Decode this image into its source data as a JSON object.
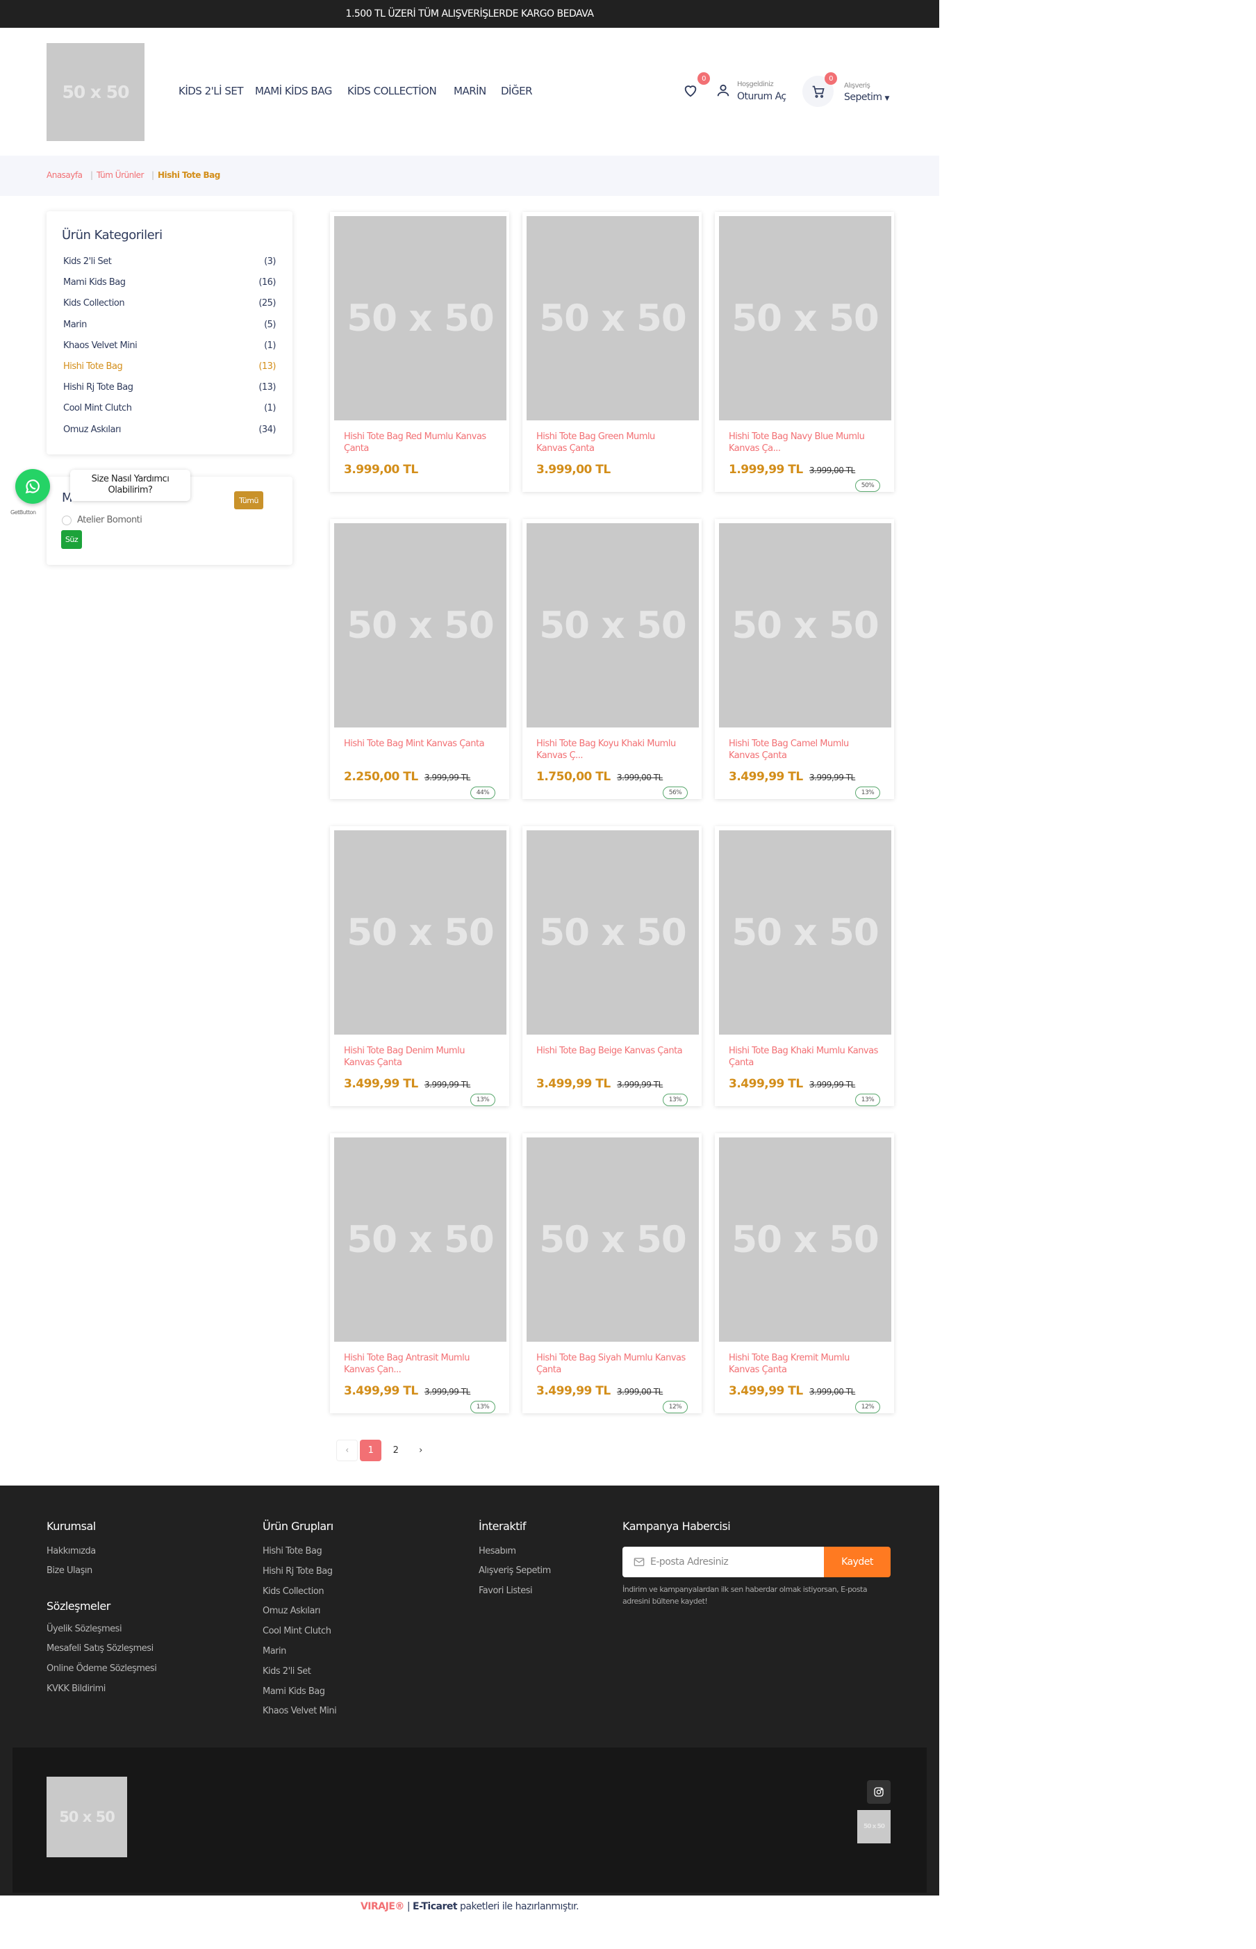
{
  "topbar": {
    "text": "1.500 TL ÜZERİ TÜM ALIŞVERİŞLERDE KARGO BEDAVA"
  },
  "logo": {
    "text": "50 x 50"
  },
  "nav": [
    "KİDS 2'Lİ SET",
    "MAMİ KİDS BAG",
    "KİDS COLLECTİON",
    "MARİN",
    "DİĞER"
  ],
  "header": {
    "wishlist_count": "0",
    "greeting": "Hoşgeldiniz",
    "login": "Oturum Aç",
    "cart_count": "0",
    "cart_small": "Alışveriş",
    "cart_label": "Sepetim"
  },
  "breadcrumb": [
    "Anasayfa",
    "Tüm Ürünler",
    "Hishi Tote Bag"
  ],
  "categories": {
    "title": "Ürün Kategorileri",
    "items": [
      {
        "name": "Kids 2'li Set",
        "count": "(3)"
      },
      {
        "name": "Mami Kids Bag",
        "count": "(16)"
      },
      {
        "name": "Kids Collection",
        "count": "(25)"
      },
      {
        "name": "Marin",
        "count": "(5)"
      },
      {
        "name": "Khaos Velvet Mini",
        "count": "(1)"
      },
      {
        "name": "Hishi Tote Bag",
        "count": "(13)"
      },
      {
        "name": "Hishi Rj Tote Bag",
        "count": "(13)"
      },
      {
        "name": "Cool Mint Clutch",
        "count": "(1)"
      },
      {
        "name": "Omuz Askıları",
        "count": "(34)"
      }
    ],
    "active_index": 5
  },
  "brand_filter": {
    "title_visible": "M",
    "all_button": "Tümü",
    "option": "Atelier Bomonti",
    "filter_button": "Süz"
  },
  "whatsapp": {
    "tooltip": "Size Nasıl Yardımcı Olabilirim?",
    "credit": "GetButton"
  },
  "products": [
    {
      "name": "Hishi Tote Bag Red Mumlu Kanvas Çanta",
      "price": "3.999,00 TL",
      "old": "",
      "disc": ""
    },
    {
      "name": "Hishi Tote Bag Green Mumlu Kanvas Çanta",
      "price": "3.999,00 TL",
      "old": "",
      "disc": ""
    },
    {
      "name": "Hishi Tote Bag Navy Blue Mumlu Kanvas Ça...",
      "price": "1.999,99 TL",
      "old": "3.999,00 TL",
      "disc": "50%"
    },
    {
      "name": "Hishi Tote Bag Mint Kanvas Çanta",
      "price": "2.250,00 TL",
      "old": "3.999,99 TL",
      "disc": "44%"
    },
    {
      "name": "Hishi Tote Bag Koyu Khaki Mumlu Kanvas Ç...",
      "price": "1.750,00 TL",
      "old": "3.999,00 TL",
      "disc": "56%"
    },
    {
      "name": "Hishi Tote Bag Camel Mumlu Kanvas Çanta",
      "price": "3.499,99 TL",
      "old": "3.999,99 TL",
      "disc": "13%"
    },
    {
      "name": "Hishi Tote Bag Denim Mumlu Kanvas Çanta",
      "price": "3.499,99 TL",
      "old": "3.999,99 TL",
      "disc": "13%"
    },
    {
      "name": "Hishi Tote Bag Beige Kanvas Çanta",
      "price": "3.499,99 TL",
      "old": "3.999,99 TL",
      "disc": "13%"
    },
    {
      "name": "Hishi Tote Bag Khaki Mumlu Kanvas Çanta",
      "price": "3.499,99 TL",
      "old": "3.999,99 TL",
      "disc": "13%"
    },
    {
      "name": "Hishi Tote Bag Antrasit Mumlu Kanvas Çan...",
      "price": "3.499,99 TL",
      "old": "3.999,99 TL",
      "disc": "13%"
    },
    {
      "name": "Hishi Tote Bag Siyah Mumlu Kanvas Çanta",
      "price": "3.499,99 TL",
      "old": "3.999,00 TL",
      "disc": "12%"
    },
    {
      "name": "Hishi Tote Bag Kremit Mumlu Kanvas Çanta",
      "price": "3.499,99 TL",
      "old": "3.999,00 TL",
      "disc": "12%"
    }
  ],
  "pagination": {
    "prev": "‹",
    "pages": [
      "1",
      "2"
    ],
    "next": "›",
    "current": "1"
  },
  "footer": {
    "kurumsal": {
      "title": "Kurumsal",
      "links": [
        "Hakkımızda",
        "Bize Ulaşın"
      ]
    },
    "sozlesmeler": {
      "title": "Sözleşmeler",
      "links": [
        "Üyelik Sözleşmesi",
        "Mesafeli Satış Sözleşmesi",
        "Online Ödeme Sözleşmesi",
        "KVKK Bildirimi"
      ]
    },
    "gruplar": {
      "title": "Ürün Grupları",
      "links": [
        "Hishi Tote Bag",
        "Hishi Rj Tote Bag",
        "Kids Collection",
        "Omuz Askıları",
        "Cool Mint Clutch",
        "Marin",
        "Kids 2'li Set",
        "Mami Kids Bag",
        "Khaos Velvet Mini"
      ]
    },
    "interaktif": {
      "title": "İnteraktif",
      "links": [
        "Hesabım",
        "Alışveriş Sepetim",
        "Favori Listesi"
      ]
    },
    "newsletter": {
      "title": "Kampanya Habercisi",
      "placeholder": "E-posta Adresiniz",
      "button": "Kaydet",
      "note": "İndirim ve kampanyalardan ilk sen haberdar olmak istiyorsan, E-posta adresini bültene kaydet!"
    },
    "bottom_logo": "50 x 50",
    "small_logo": "50 x 50"
  },
  "credit": {
    "brand": "VIRAJE®",
    "sep": " | ",
    "eticaret": "E-Ticaret",
    "rest": " paketleri ile hazırlanmıştır."
  },
  "colors": {
    "accent": "#f27074",
    "price": "#d38e1a",
    "active_cat": "#d38e1a",
    "save": "#ff7a21",
    "whatsapp": "#25d366"
  }
}
